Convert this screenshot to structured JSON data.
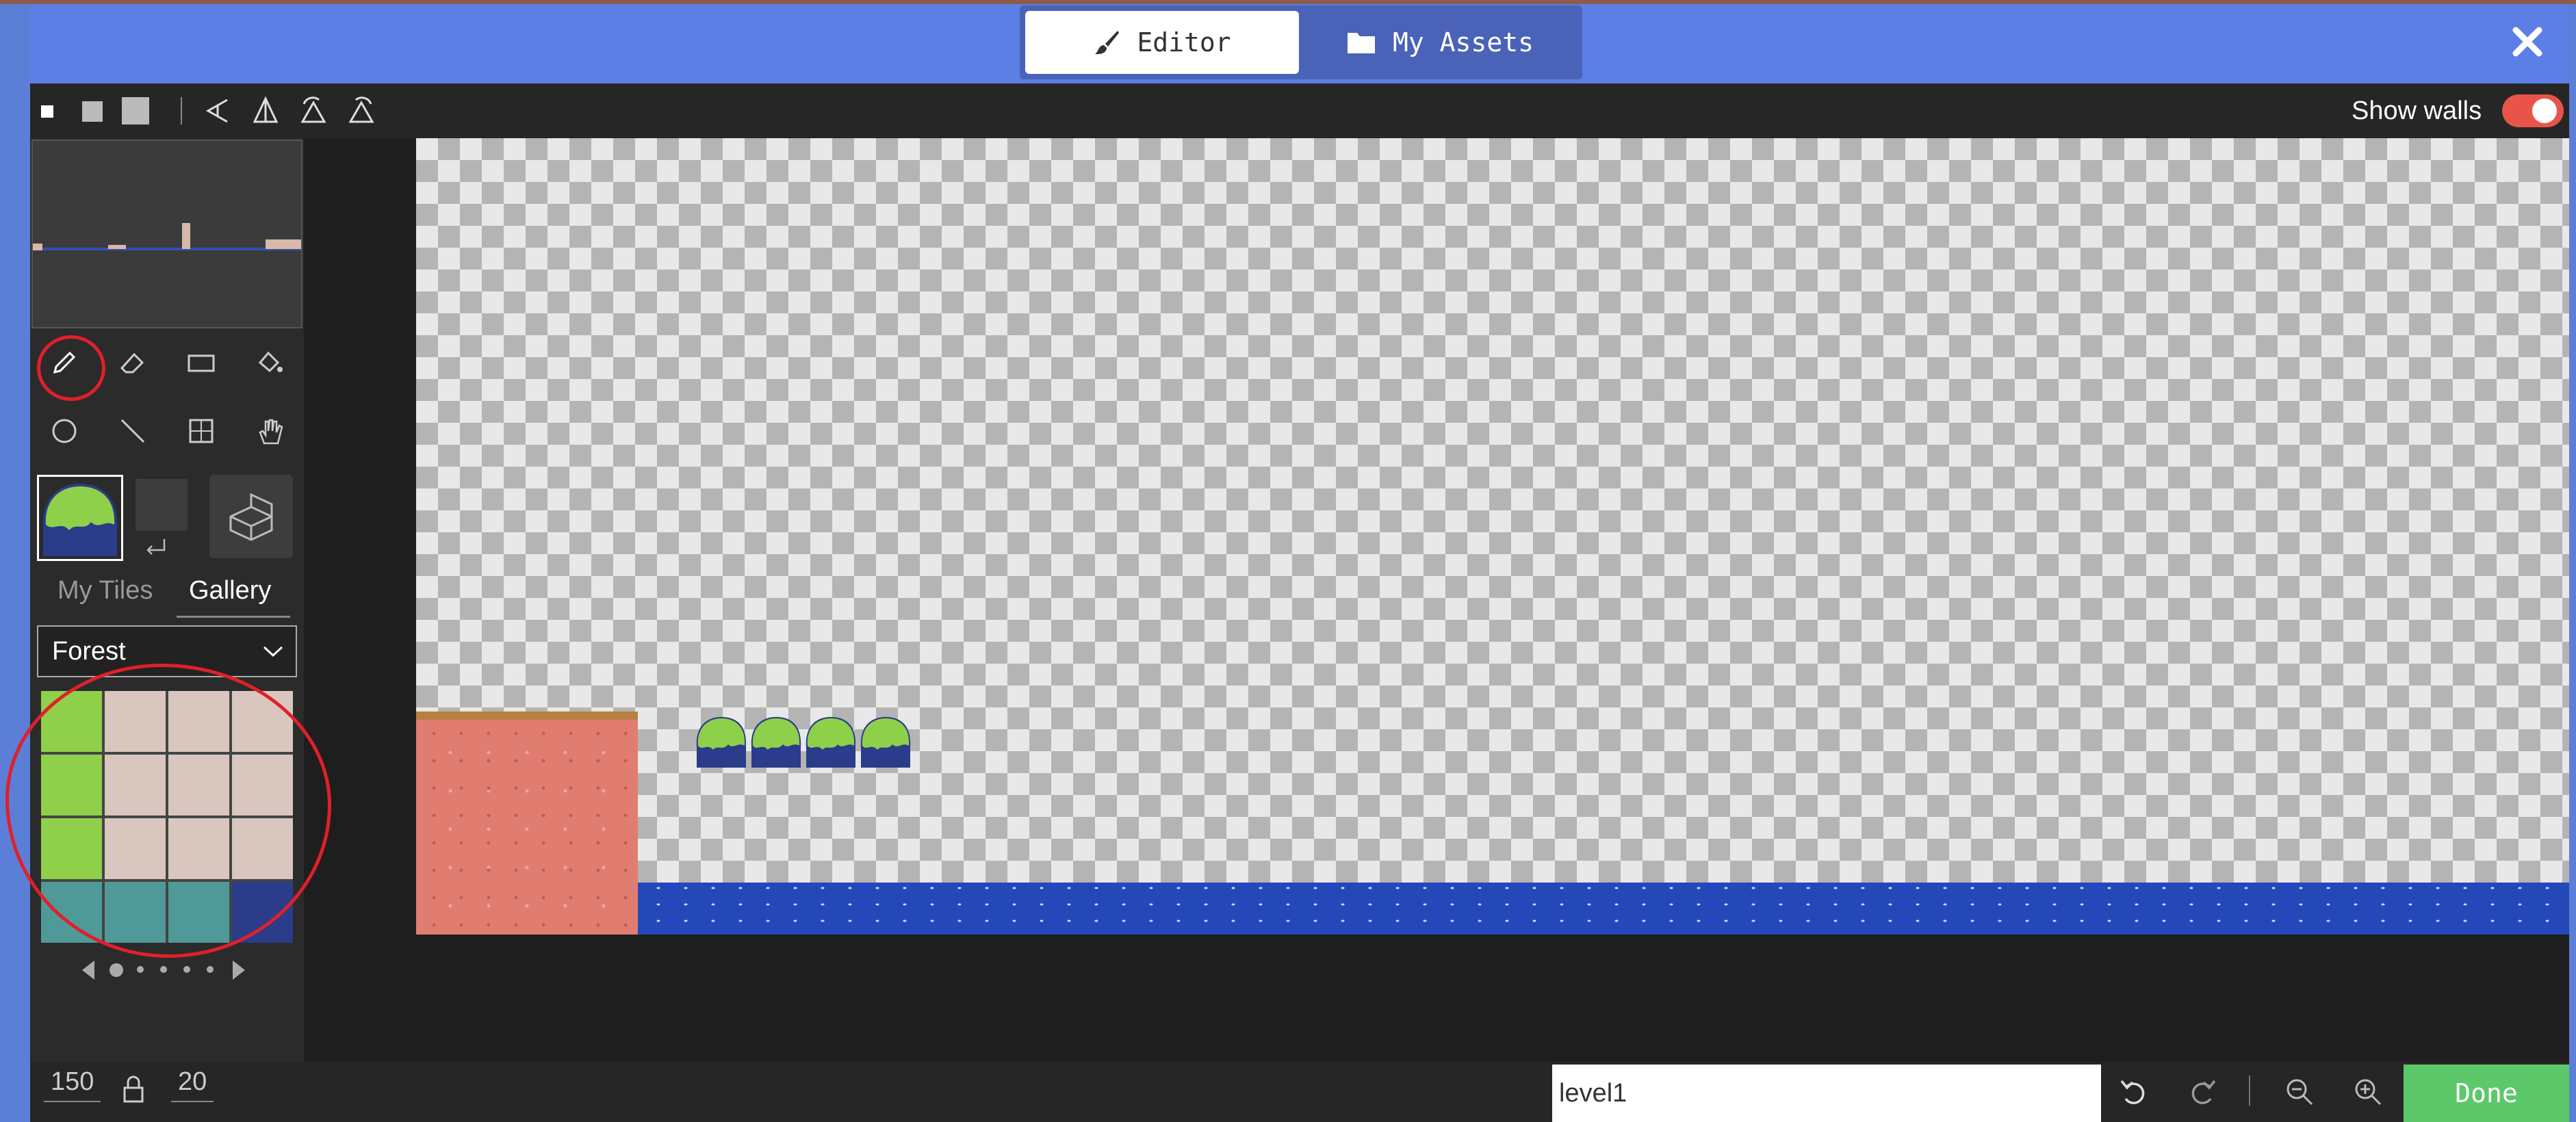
{
  "header": {
    "tabs": [
      {
        "label": "Editor",
        "icon": "brush-icon",
        "active": true
      },
      {
        "label": "My Assets",
        "icon": "folder-icon",
        "active": false
      }
    ],
    "close_icon": "close-icon"
  },
  "toolbar": {
    "brush_sizes": [
      "small-square-icon",
      "medium-square-icon",
      "large-square-icon"
    ],
    "transform_icons": [
      "flip-horizontal-icon",
      "flip-vertical-icon",
      "rotate-left-icon",
      "rotate-right-icon"
    ],
    "show_walls_label": "Show walls",
    "show_walls_on": true
  },
  "sidebar": {
    "tools": [
      "pencil-icon",
      "eraser-icon",
      "rectangle-icon",
      "fill-bucket-icon",
      "circle-icon",
      "line-icon",
      "marquee-icon",
      "hand-icon"
    ],
    "selected_tool": "pencil-icon",
    "tile_tabs": [
      "My Tiles",
      "Gallery"
    ],
    "active_tile_tab": "Gallery",
    "tileset": "Forest",
    "tile_colors": [
      "#8fcf4a",
      "#d9c7bf",
      "#d9c7bf",
      "#d9c7bf",
      "#8fcf4a",
      "#d9c7bf",
      "#d9c7bf",
      "#d9c7bf",
      "#8fcf4a",
      "#d9c7bf",
      "#d9c7bf",
      "#d9c7bf",
      "#4f9a98",
      "#4f9a98",
      "#4f9a98",
      "#2a3c8a"
    ]
  },
  "colors": {
    "accent": "#5b7fe4",
    "done": "#5cc86a",
    "toggle": "#e8544a",
    "annotation": "#e0202a"
  },
  "footer": {
    "width": "150",
    "height": "20",
    "lock_icon": "lock-icon",
    "level_name": "level1",
    "undo_icon": "undo-icon",
    "redo_icon": "redo-icon",
    "zoom_out_icon": "zoom-out-icon",
    "zoom_in_icon": "zoom-in-icon",
    "done_label": "Done"
  }
}
